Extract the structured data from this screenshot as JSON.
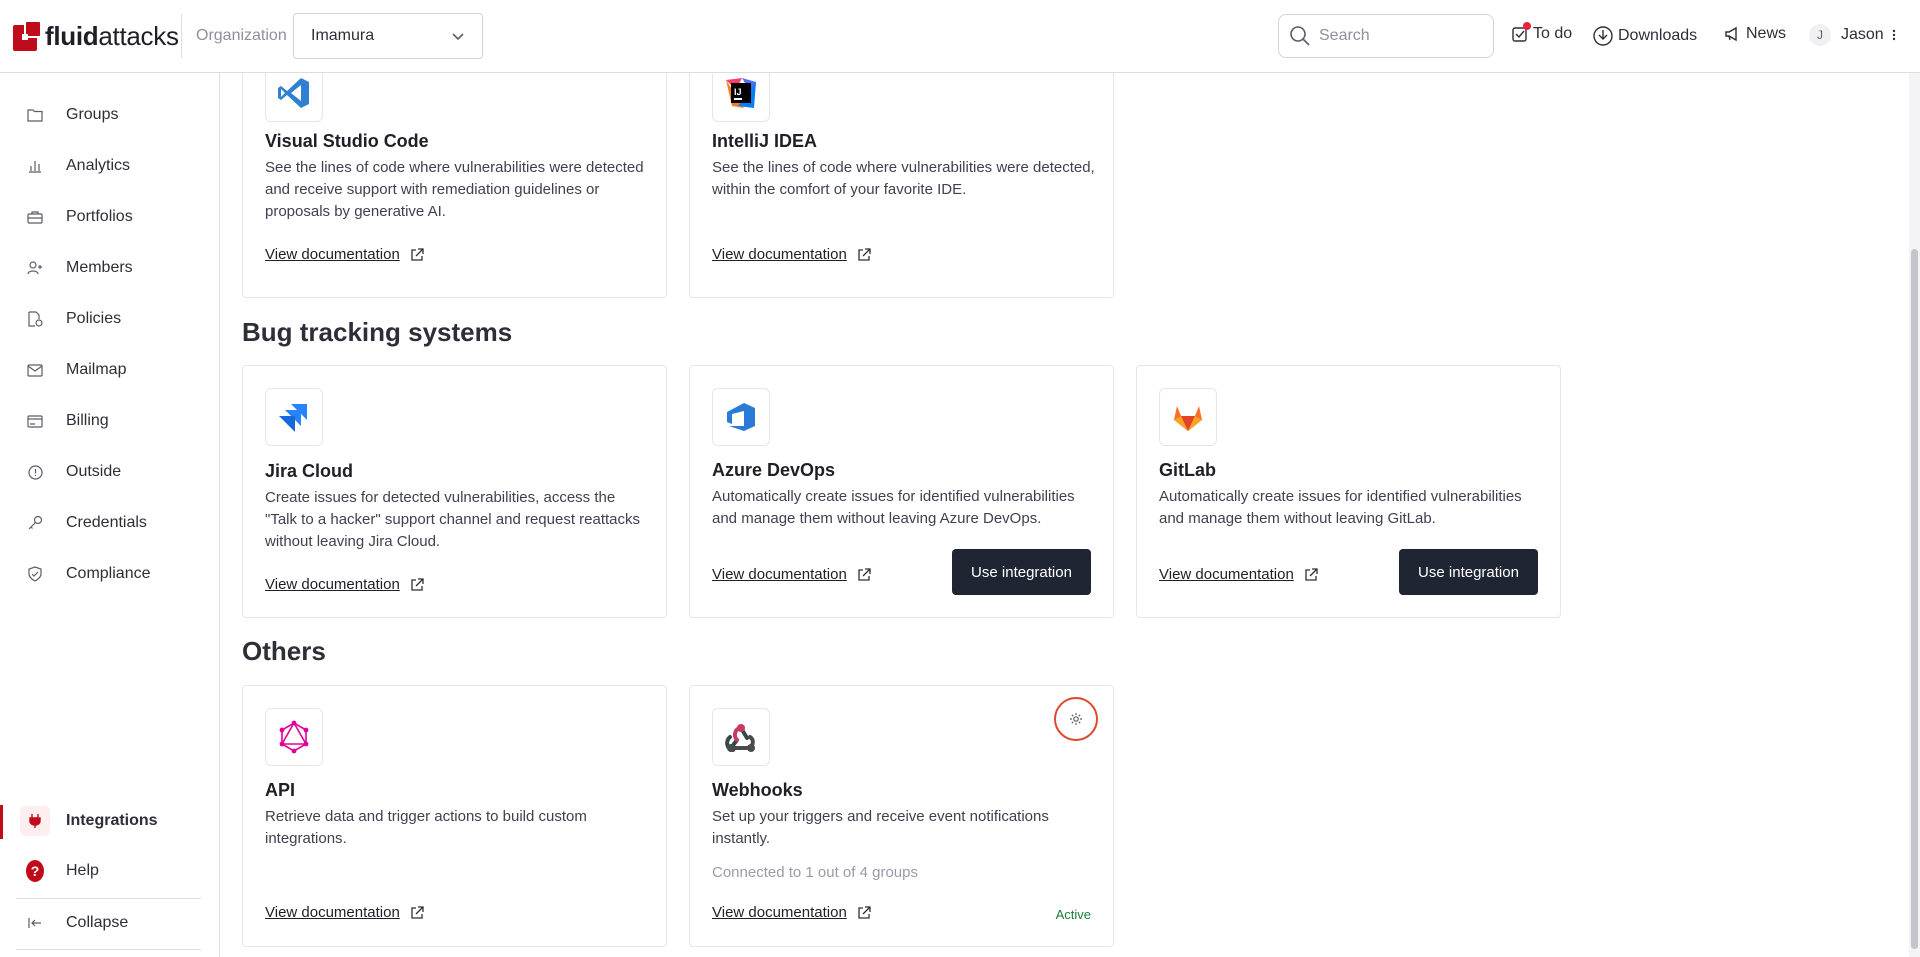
{
  "header": {
    "brand_bold": "fluid",
    "brand_light": "attacks",
    "org_label": "Organization",
    "org_value": "Imamura",
    "search_placeholder": "Search",
    "todo": "To do",
    "downloads": "Downloads",
    "news": "News",
    "user_initial": "J",
    "user_name": "Jason"
  },
  "sidebar": {
    "items": [
      {
        "label": "Groups",
        "icon": "folder-icon"
      },
      {
        "label": "Analytics",
        "icon": "bar-chart-icon"
      },
      {
        "label": "Portfolios",
        "icon": "briefcase-icon"
      },
      {
        "label": "Members",
        "icon": "user-plus-icon"
      },
      {
        "label": "Policies",
        "icon": "policy-icon"
      },
      {
        "label": "Mailmap",
        "icon": "mail-icon"
      },
      {
        "label": "Billing",
        "icon": "billing-icon"
      },
      {
        "label": "Outside",
        "icon": "info-circle-icon"
      },
      {
        "label": "Credentials",
        "icon": "key-icon"
      },
      {
        "label": "Compliance",
        "icon": "shield-check-icon"
      }
    ],
    "active": {
      "label": "Integrations",
      "icon": "plug-icon"
    },
    "help": "Help",
    "collapse": "Collapse"
  },
  "sections": {
    "bug_tracking": "Bug tracking systems",
    "others": "Others"
  },
  "cards": {
    "vscode": {
      "title": "Visual Studio Code",
      "desc": "See the lines of code where vulnerabilities were detected and receive support with remediation guidelines or proposals by generative AI.",
      "doc": "View documentation"
    },
    "intellij": {
      "title": "IntelliJ IDEA",
      "desc": "See the lines of code where vulnerabilities were detected, within the comfort of your favorite IDE.",
      "doc": "View documentation"
    },
    "jira": {
      "title": "Jira Cloud",
      "desc": "Create issues for detected vulnerabilities, access the \"Talk to a hacker\" support channel and request reattacks without leaving Jira Cloud.",
      "doc": "View documentation"
    },
    "azure": {
      "title": "Azure DevOps",
      "desc": "Automatically create issues for identified vulnerabilities and manage them without leaving Azure DevOps.",
      "doc": "View documentation",
      "button": "Use integration"
    },
    "gitlab": {
      "title": "GitLab",
      "desc": "Automatically create issues for identified vulnerabilities and manage them without leaving GitLab.",
      "doc": "View documentation",
      "button": "Use integration"
    },
    "api": {
      "title": "API",
      "desc": "Retrieve data and trigger actions to build custom integrations.",
      "doc": "View documentation"
    },
    "webhooks": {
      "title": "Webhooks",
      "desc": "Set up your triggers and receive event notifications instantly.",
      "connected": "Connected to 1 out of 4 groups",
      "doc": "View documentation",
      "status": "Active"
    }
  },
  "colors": {
    "brand": "#bf0b1a",
    "button_dark": "#1f2532",
    "active_green": "#1b7e3a",
    "highlight_ring": "#e0472f"
  }
}
